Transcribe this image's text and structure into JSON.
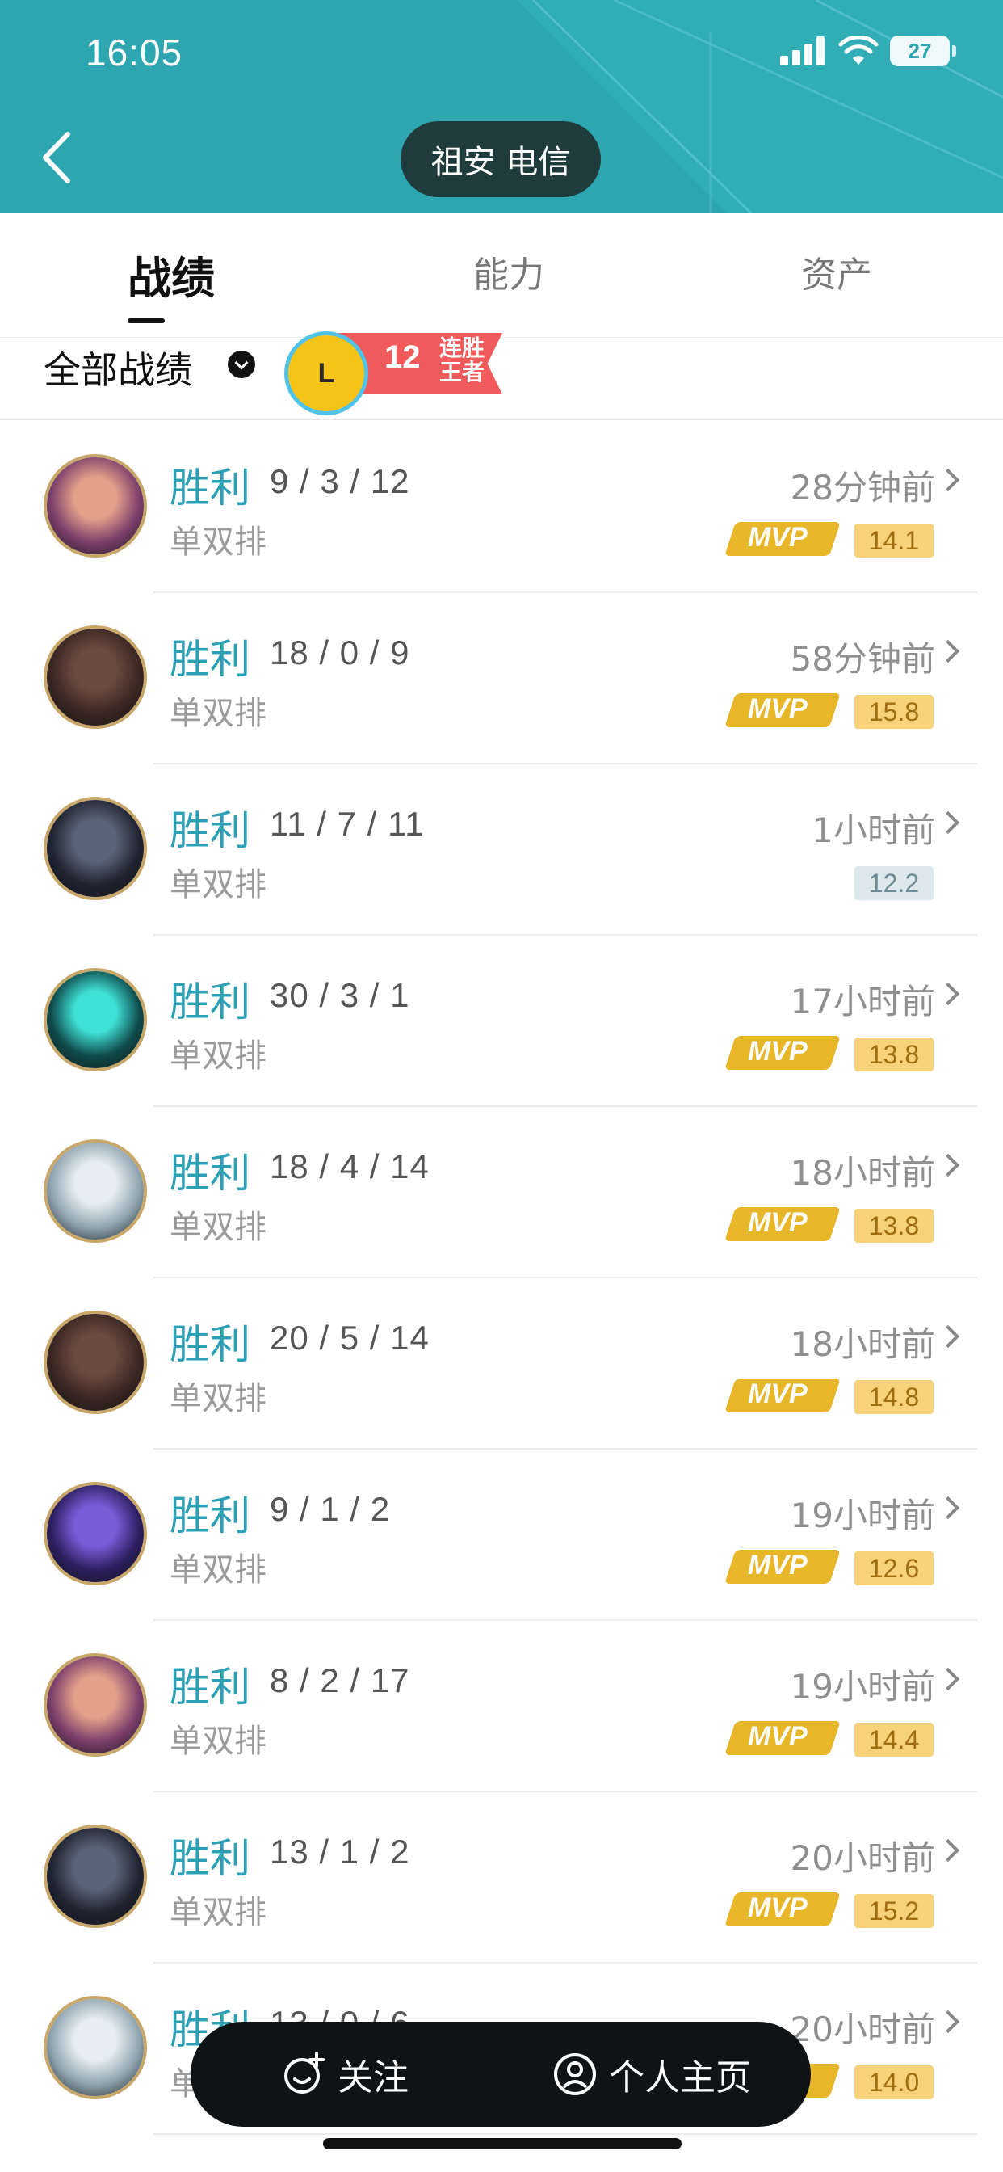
{
  "status_bar": {
    "time": "16:05",
    "battery": "27"
  },
  "header": {
    "server": "祖安 电信"
  },
  "tabs": [
    {
      "label": "战绩",
      "active": true
    },
    {
      "label": "能力",
      "active": false
    },
    {
      "label": "资产",
      "active": false
    }
  ],
  "filter": {
    "label": "全部战绩",
    "streak": {
      "count": "12",
      "title": "连胜王者",
      "trophy_letter": "L"
    }
  },
  "matches": [
    {
      "result": "胜利",
      "kda": "9 / 3 / 12",
      "mode": "单双排",
      "time": "28分钟前",
      "mvp": true,
      "score": "14.1",
      "avatar": "champion-1"
    },
    {
      "result": "胜利",
      "kda": "18 / 0 / 9",
      "mode": "单双排",
      "time": "58分钟前",
      "mvp": true,
      "score": "15.8",
      "avatar": "champion-2"
    },
    {
      "result": "胜利",
      "kda": "11 / 7 / 11",
      "mode": "单双排",
      "time": "1小时前",
      "mvp": false,
      "score": "12.2",
      "avatar": "champion-3"
    },
    {
      "result": "胜利",
      "kda": "30 / 3 / 1",
      "mode": "单双排",
      "time": "17小时前",
      "mvp": true,
      "score": "13.8",
      "avatar": "champion-4"
    },
    {
      "result": "胜利",
      "kda": "18 / 4 / 14",
      "mode": "单双排",
      "time": "18小时前",
      "mvp": true,
      "score": "13.8",
      "avatar": "champion-5"
    },
    {
      "result": "胜利",
      "kda": "20 / 5 / 14",
      "mode": "单双排",
      "time": "18小时前",
      "mvp": true,
      "score": "14.8",
      "avatar": "champion-2"
    },
    {
      "result": "胜利",
      "kda": "9 / 1 / 2",
      "mode": "单双排",
      "time": "19小时前",
      "mvp": true,
      "score": "12.6",
      "avatar": "champion-6"
    },
    {
      "result": "胜利",
      "kda": "8 / 2 / 17",
      "mode": "单双排",
      "time": "19小时前",
      "mvp": true,
      "score": "14.4",
      "avatar": "champion-1"
    },
    {
      "result": "胜利",
      "kda": "13 / 1 / 2",
      "mode": "单双排",
      "time": "20小时前",
      "mvp": true,
      "score": "15.2",
      "avatar": "champion-3"
    },
    {
      "result": "胜利",
      "kda": "13 / 0 / 6",
      "mode": "单双排",
      "time": "20小时前",
      "mvp": true,
      "score": "14.0",
      "avatar": "champion-5"
    }
  ],
  "mvp_label": "MVP",
  "bottom_bar": {
    "follow": "关注",
    "profile": "个人主页"
  },
  "colors": {
    "header_teal": "#2ea6b0",
    "result_teal": "#2ca0b4",
    "mvp_gold": "#e8b629",
    "score_gold_bg": "#f7d27a",
    "score_gray_bg": "#dde8ec"
  }
}
